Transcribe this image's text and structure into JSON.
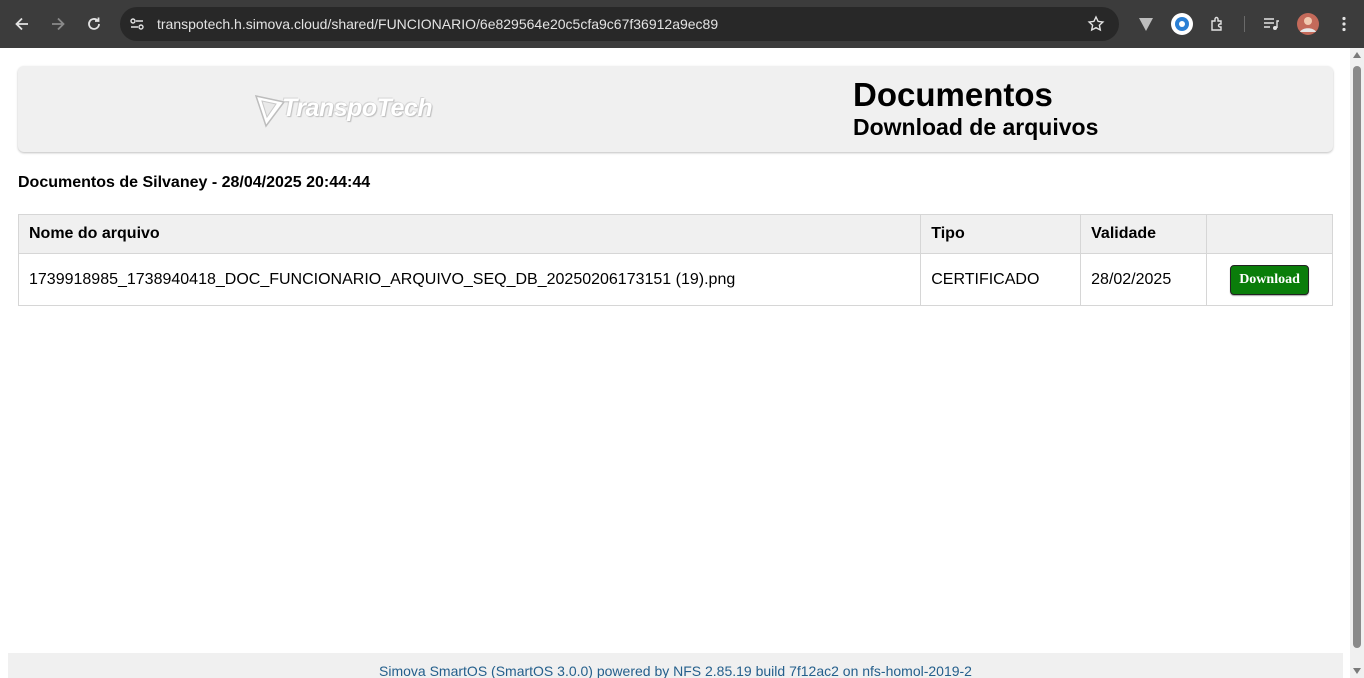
{
  "browser": {
    "url": "transpotech.h.simova.cloud/shared/FUNCIONARIO/6e829564e20c5cfa9c67f36912a9ec89",
    "icons": [
      "back-icon",
      "forward-icon",
      "reload-icon",
      "site-info-icon",
      "bookmark-star-icon",
      "vivaldi-extension-icon",
      "edge-extension-icon",
      "extensions-puzzle-icon",
      "media-queue-icon",
      "profile-avatar",
      "menu-kebab-icon"
    ]
  },
  "header": {
    "logo_text": "TranspoTech",
    "title": "Documentos",
    "subtitle": "Download de arquivos"
  },
  "page": {
    "documents_of": "Documentos de Silvaney - 28/04/2025 20:44:44"
  },
  "table": {
    "columns": [
      "Nome do arquivo",
      "Tipo",
      "Validade",
      ""
    ],
    "rows": [
      {
        "file_name": "1739918985_1738940418_DOC_FUNCIONARIO_ARQUIVO_SEQ_DB_20250206173151 (19).png",
        "type": "CERTIFICADO",
        "validity": "28/02/2025",
        "action_label": "Download"
      }
    ]
  },
  "footer": {
    "text": "Simova SmartOS (SmartOS 3.0.0) powered by NFS 2.85.19 build 7f12ac2 on nfs-homol-2019-2"
  },
  "colors": {
    "chrome_bg": "#3c3c3c",
    "omnibox_bg": "#282828",
    "header_bg": "#f0f0f0",
    "download_button": "#0a7d0a",
    "footer_text": "#245f8c"
  }
}
